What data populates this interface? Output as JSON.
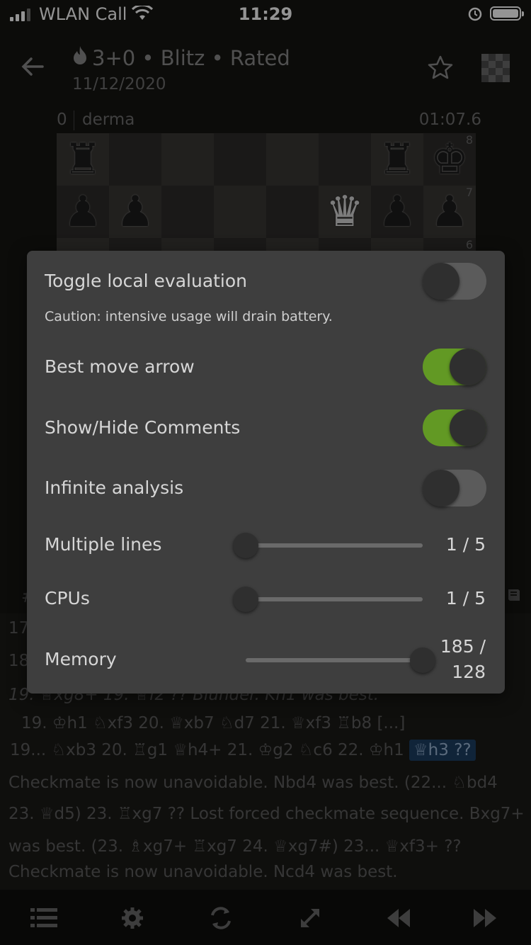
{
  "status_bar": {
    "carrier": "WLAN Call",
    "time": "11:29"
  },
  "header": {
    "title": "3+0 • Blitz • Rated",
    "date": "11/12/2020"
  },
  "player": {
    "score": "0",
    "name": "derma",
    "clock": "01:07.6"
  },
  "board": {
    "ranks": [
      "8",
      "7",
      "6"
    ]
  },
  "settings": {
    "local_eval": {
      "label": "Toggle local evaluation",
      "on": false
    },
    "caution": "Caution: intensive usage will drain battery.",
    "best_move_arrow": {
      "label": "Best move arrow",
      "on": true
    },
    "show_hide_comments": {
      "label": "Show/Hide Comments",
      "on": true
    },
    "infinite_analysis": {
      "label": "Infinite analysis",
      "on": false
    },
    "multiple_lines": {
      "label": "Multiple lines",
      "value": 1,
      "max": 5,
      "display": "1 / 5"
    },
    "cpus": {
      "label": "CPUs",
      "value": 1,
      "max": 5,
      "display": "1 / 5"
    },
    "memory": {
      "label": "Memory",
      "value": 185,
      "max": 128,
      "display_top": "185 /",
      "display_bottom": "128"
    }
  },
  "moves": {
    "hash": "#",
    "l1": "17",
    "l2": "18",
    "l3": "19. ♕xg8+  19. ♕f2 ?? Blunder. Kh1 was best.",
    "l4": "19. ♔h1 ♘xf3 20. ♕xb7 ♘d7 21. ♕xf3 ♖b8 [...]",
    "l5a": "19... ♘xb3 20. ♖g1 ♕h4+ 21. ♔g2 ♘c6 22. ♔h1",
    "l5hl": "♕h3 ??",
    "l6": "Checkmate is now unavoidable. Nbd4 was best. (22... ♘bd4",
    "l7": "23. ♕d5) 23. ♖xg7 ?? Lost forced checkmate sequence. Bxg7+",
    "l8": "was best. (23. ♗xg7+ ♖xg7 24. ♕xg7#) 23... ♕xf3+ ??",
    "l9": "Checkmate is now unavoidable. Ncd4 was best."
  },
  "colors": {
    "accent_green": "#629924",
    "highlight_blue": "#1c3e63"
  }
}
